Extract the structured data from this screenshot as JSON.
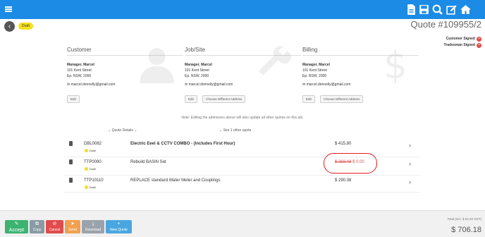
{
  "topbar": {
    "color": "#1b8be6",
    "icons": [
      "hamburger-icon",
      "document-icon",
      "save-icon",
      "search-icon",
      "edit-icon",
      "home-icon"
    ]
  },
  "header": {
    "back_glyph": "‹",
    "status": "Draft",
    "quote_number": "Quote #109955/2",
    "signatures": [
      "Customer Signed",
      "Tradesman Signed"
    ]
  },
  "columns": [
    {
      "heading": "Customer",
      "name": "Manager, Marcel",
      "line1": "101 Kent Street",
      "line2": "Ep. NSW, 2000",
      "email": "marcel.donnelly@gmail.com",
      "buttons": [
        "Edit"
      ]
    },
    {
      "heading": "Job/Site",
      "name": "Manager, Marcel",
      "line1": "101 Kent Street",
      "line2": "Ep. NSW, 2000",
      "email": "marcel.donnelly@gmail.com",
      "buttons": [
        "Edit",
        "Choose Different Address"
      ]
    },
    {
      "heading": "Billing",
      "name": "Manager, Marcel",
      "line1": "101 Kent Street",
      "line2": "Ep. NSW, 2000",
      "email": "marcel.donnelly@gmail.com",
      "buttons": [
        "Edit",
        "Choose Different Address"
      ]
    }
  ],
  "note": "Note: Editing the addresses above will also update all other quotes on this job.",
  "toggles": {
    "details": "Quote Details",
    "other": "See 1 other quote"
  },
  "items": [
    {
      "code": "DBL0082",
      "status": "Draft",
      "desc": "Electric Eeel & CCTV COMBO - (Includes First Hour)",
      "price": "$ 415.80",
      "old_price": ""
    },
    {
      "code": "TTP0090",
      "status": "Draft",
      "desc": "Rebuild BASIN Set",
      "price": "$ 0.00",
      "old_price": "$ 293.48"
    },
    {
      "code": "TTP10110",
      "status": "Draft",
      "desc": "REPLACE standard Water Meter and Couplings",
      "price": "$ 290.38",
      "old_price": ""
    }
  ],
  "footer": {
    "total_label": "Total (incl. $ 64.20 GST)",
    "total": "$ 706.18",
    "buttons": [
      {
        "label": "Accept",
        "color": "#3cb371",
        "icon": "edit-icon"
      },
      {
        "label": "Copy",
        "color": "#8a9aa6",
        "icon": "copy-icon"
      },
      {
        "label": "Cancel",
        "color": "#e14b4b",
        "icon": "cancel-icon"
      },
      {
        "label": "Send",
        "color": "#f0a050",
        "icon": "send-icon"
      },
      {
        "label": "Download",
        "color": "#9aa3ab",
        "icon": "download-icon"
      },
      {
        "label": "New Quote",
        "color": "#4aa6e0",
        "icon": "plus-icon"
      }
    ]
  }
}
